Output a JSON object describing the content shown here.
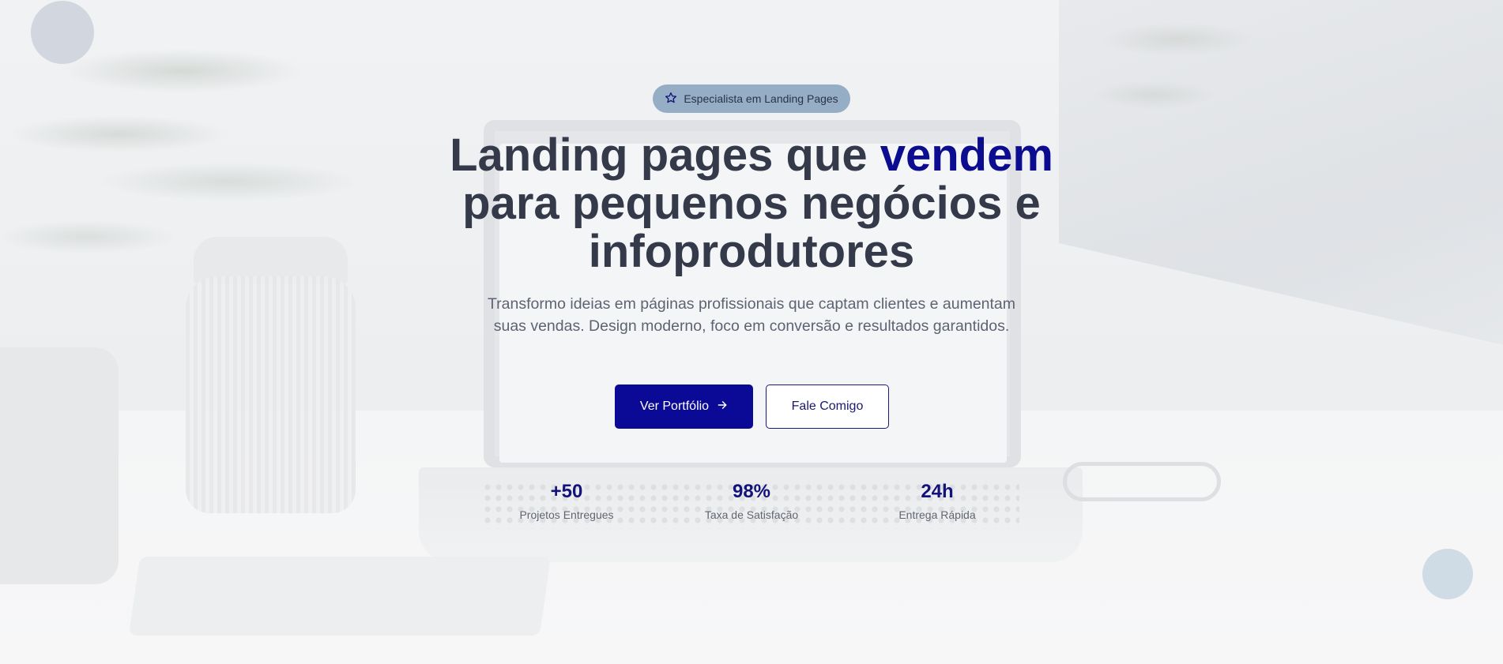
{
  "hero": {
    "badge": {
      "icon": "star-icon",
      "label": "Especialista em Landing Pages"
    },
    "headline": {
      "part1": "Landing pages que ",
      "accent": "vendem",
      "part2": " para pequenos negócios e infoprodutores"
    },
    "subtitle": "Transformo ideias em páginas profissionais que captam clientes e aumentam suas vendas. Design moderno, foco em conversão e resultados garantidos.",
    "buttons": {
      "primary": {
        "label": "Ver Portfólio",
        "icon": "arrow-right-icon"
      },
      "secondary": {
        "label": "Fale Comigo"
      }
    },
    "stats": [
      {
        "value": "+50",
        "label": "Projetos Entregues"
      },
      {
        "value": "98%",
        "label": "Taxa de Satisfação"
      },
      {
        "value": "24h",
        "label": "Entrega Rápida"
      }
    ]
  },
  "colors": {
    "accent": "#0c0c90",
    "primary_button": "#0a0a96",
    "badge_background": "#96adc6",
    "headline_text": "#343a4a",
    "subtitle_text": "#5d6372"
  }
}
